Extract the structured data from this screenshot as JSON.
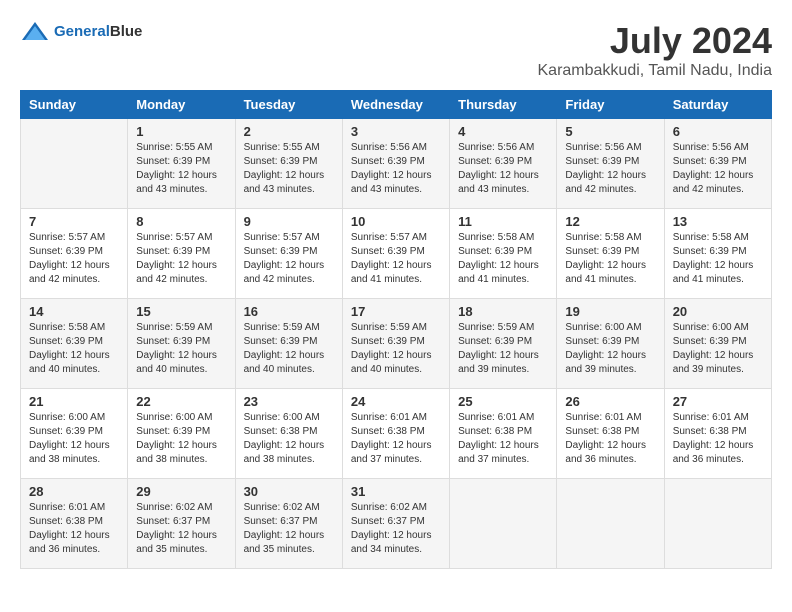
{
  "logo": {
    "text1": "General",
    "text2": "Blue"
  },
  "title": "July 2024",
  "subtitle": "Karambakkudi, Tamil Nadu, India",
  "days_of_week": [
    "Sunday",
    "Monday",
    "Tuesday",
    "Wednesday",
    "Thursday",
    "Friday",
    "Saturday"
  ],
  "weeks": [
    [
      {
        "day": "",
        "info": ""
      },
      {
        "day": "1",
        "info": "Sunrise: 5:55 AM\nSunset: 6:39 PM\nDaylight: 12 hours\nand 43 minutes."
      },
      {
        "day": "2",
        "info": "Sunrise: 5:55 AM\nSunset: 6:39 PM\nDaylight: 12 hours\nand 43 minutes."
      },
      {
        "day": "3",
        "info": "Sunrise: 5:56 AM\nSunset: 6:39 PM\nDaylight: 12 hours\nand 43 minutes."
      },
      {
        "day": "4",
        "info": "Sunrise: 5:56 AM\nSunset: 6:39 PM\nDaylight: 12 hours\nand 43 minutes."
      },
      {
        "day": "5",
        "info": "Sunrise: 5:56 AM\nSunset: 6:39 PM\nDaylight: 12 hours\nand 42 minutes."
      },
      {
        "day": "6",
        "info": "Sunrise: 5:56 AM\nSunset: 6:39 PM\nDaylight: 12 hours\nand 42 minutes."
      }
    ],
    [
      {
        "day": "7",
        "info": "Sunrise: 5:57 AM\nSunset: 6:39 PM\nDaylight: 12 hours\nand 42 minutes."
      },
      {
        "day": "8",
        "info": "Sunrise: 5:57 AM\nSunset: 6:39 PM\nDaylight: 12 hours\nand 42 minutes."
      },
      {
        "day": "9",
        "info": "Sunrise: 5:57 AM\nSunset: 6:39 PM\nDaylight: 12 hours\nand 42 minutes."
      },
      {
        "day": "10",
        "info": "Sunrise: 5:57 AM\nSunset: 6:39 PM\nDaylight: 12 hours\nand 41 minutes."
      },
      {
        "day": "11",
        "info": "Sunrise: 5:58 AM\nSunset: 6:39 PM\nDaylight: 12 hours\nand 41 minutes."
      },
      {
        "day": "12",
        "info": "Sunrise: 5:58 AM\nSunset: 6:39 PM\nDaylight: 12 hours\nand 41 minutes."
      },
      {
        "day": "13",
        "info": "Sunrise: 5:58 AM\nSunset: 6:39 PM\nDaylight: 12 hours\nand 41 minutes."
      }
    ],
    [
      {
        "day": "14",
        "info": "Sunrise: 5:58 AM\nSunset: 6:39 PM\nDaylight: 12 hours\nand 40 minutes."
      },
      {
        "day": "15",
        "info": "Sunrise: 5:59 AM\nSunset: 6:39 PM\nDaylight: 12 hours\nand 40 minutes."
      },
      {
        "day": "16",
        "info": "Sunrise: 5:59 AM\nSunset: 6:39 PM\nDaylight: 12 hours\nand 40 minutes."
      },
      {
        "day": "17",
        "info": "Sunrise: 5:59 AM\nSunset: 6:39 PM\nDaylight: 12 hours\nand 40 minutes."
      },
      {
        "day": "18",
        "info": "Sunrise: 5:59 AM\nSunset: 6:39 PM\nDaylight: 12 hours\nand 39 minutes."
      },
      {
        "day": "19",
        "info": "Sunrise: 6:00 AM\nSunset: 6:39 PM\nDaylight: 12 hours\nand 39 minutes."
      },
      {
        "day": "20",
        "info": "Sunrise: 6:00 AM\nSunset: 6:39 PM\nDaylight: 12 hours\nand 39 minutes."
      }
    ],
    [
      {
        "day": "21",
        "info": "Sunrise: 6:00 AM\nSunset: 6:39 PM\nDaylight: 12 hours\nand 38 minutes."
      },
      {
        "day": "22",
        "info": "Sunrise: 6:00 AM\nSunset: 6:39 PM\nDaylight: 12 hours\nand 38 minutes."
      },
      {
        "day": "23",
        "info": "Sunrise: 6:00 AM\nSunset: 6:38 PM\nDaylight: 12 hours\nand 38 minutes."
      },
      {
        "day": "24",
        "info": "Sunrise: 6:01 AM\nSunset: 6:38 PM\nDaylight: 12 hours\nand 37 minutes."
      },
      {
        "day": "25",
        "info": "Sunrise: 6:01 AM\nSunset: 6:38 PM\nDaylight: 12 hours\nand 37 minutes."
      },
      {
        "day": "26",
        "info": "Sunrise: 6:01 AM\nSunset: 6:38 PM\nDaylight: 12 hours\nand 36 minutes."
      },
      {
        "day": "27",
        "info": "Sunrise: 6:01 AM\nSunset: 6:38 PM\nDaylight: 12 hours\nand 36 minutes."
      }
    ],
    [
      {
        "day": "28",
        "info": "Sunrise: 6:01 AM\nSunset: 6:38 PM\nDaylight: 12 hours\nand 36 minutes."
      },
      {
        "day": "29",
        "info": "Sunrise: 6:02 AM\nSunset: 6:37 PM\nDaylight: 12 hours\nand 35 minutes."
      },
      {
        "day": "30",
        "info": "Sunrise: 6:02 AM\nSunset: 6:37 PM\nDaylight: 12 hours\nand 35 minutes."
      },
      {
        "day": "31",
        "info": "Sunrise: 6:02 AM\nSunset: 6:37 PM\nDaylight: 12 hours\nand 34 minutes."
      },
      {
        "day": "",
        "info": ""
      },
      {
        "day": "",
        "info": ""
      },
      {
        "day": "",
        "info": ""
      }
    ]
  ]
}
